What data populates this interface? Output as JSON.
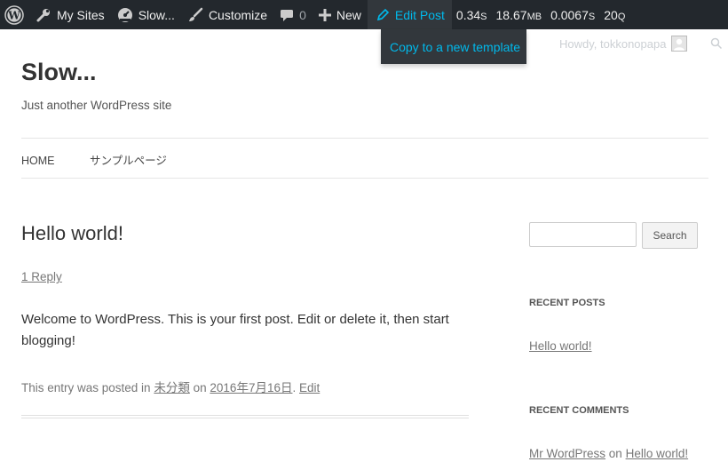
{
  "admin_bar": {
    "my_sites": "My Sites",
    "site_name": "Slow...",
    "customize": "Customize",
    "comments_count": "0",
    "new": "New",
    "edit_post": "Edit Post",
    "stats": [
      {
        "value": "0.34",
        "unit": "S"
      },
      {
        "value": "18.67",
        "unit": "MB"
      },
      {
        "value": "0.0067",
        "unit": "S"
      },
      {
        "value": "20",
        "unit": "Q"
      }
    ],
    "dropdown_item": "Copy to a new template",
    "howdy": "Howdy, tokkonopapa"
  },
  "site": {
    "title": "Slow...",
    "description": "Just another WordPress site"
  },
  "nav": [
    "HOME",
    "サンプルページ"
  ],
  "post": {
    "title": "Hello world!",
    "reply_link": "1 Reply",
    "body": "Welcome to WordPress. This is your first post. Edit or delete it, then start blogging!",
    "meta": {
      "prefix": "This entry was posted in",
      "category": "未分類",
      "on": "on",
      "date": "2016年7月16日",
      "dot": ".",
      "edit": "Edit"
    }
  },
  "sidebar": {
    "search_button": "Search",
    "recent_posts_title": "RECENT POSTS",
    "recent_posts": [
      "Hello world!"
    ],
    "recent_comments_title": "RECENT COMMENTS",
    "recent_comment": {
      "author": "Mr WordPress",
      "on": "on",
      "post": "Hello world!"
    }
  },
  "colors": {
    "admin_bar_bg": "#23282d",
    "admin_bar_active": "#00b9eb",
    "dropdown_bg": "#32373c"
  }
}
